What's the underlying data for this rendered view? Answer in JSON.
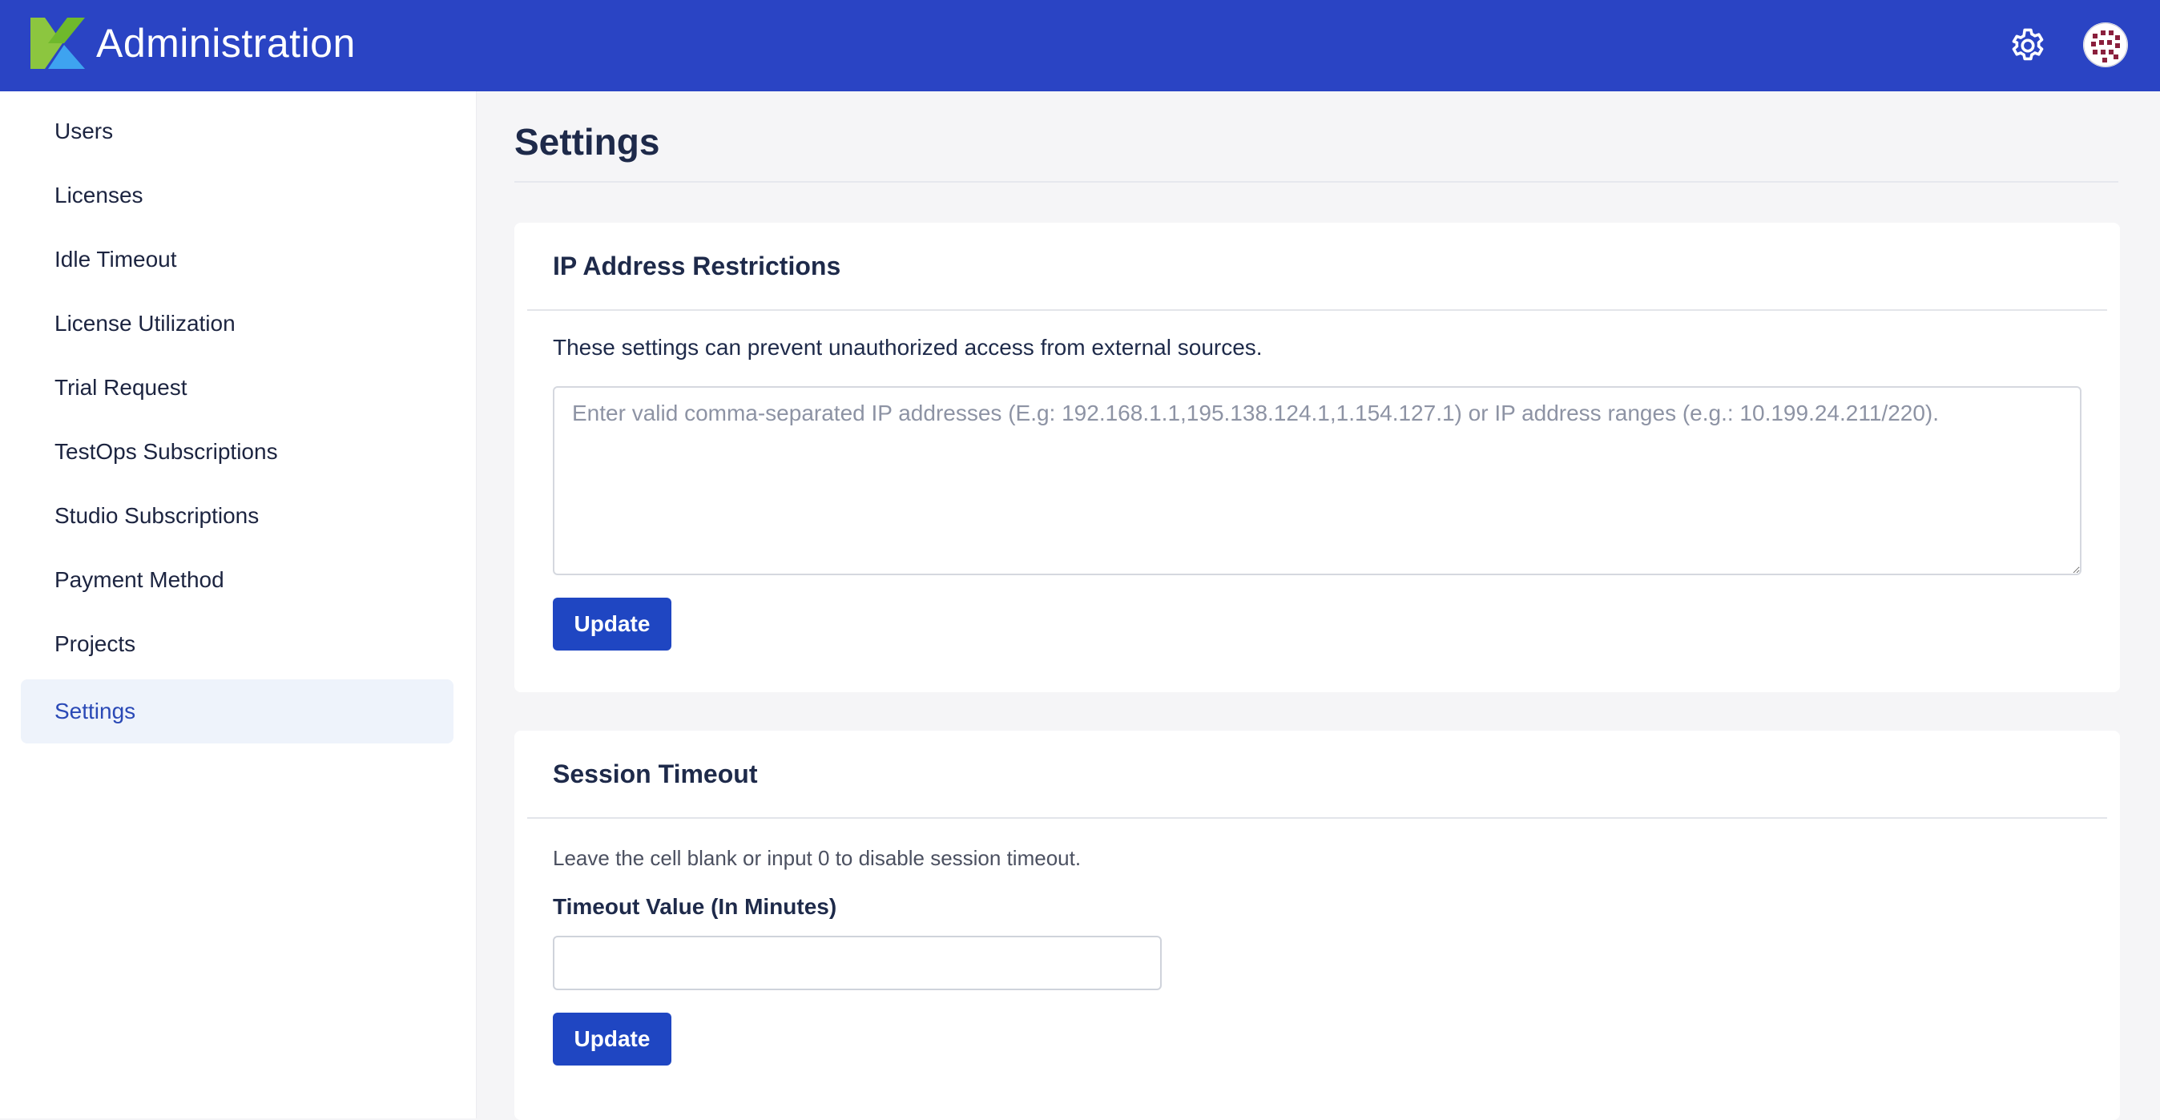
{
  "header": {
    "title": "Administration",
    "logo_icon": "katalon-k-logo-icon",
    "settings_icon": "gear-icon",
    "avatar_icon": "user-avatar-icon",
    "colors": {
      "bar": "#2a44c4",
      "logo_green": "#8cc63f",
      "logo_blue": "#3ea3f0"
    }
  },
  "sidebar": {
    "items": [
      {
        "label": "Users"
      },
      {
        "label": "Licenses"
      },
      {
        "label": "Idle Timeout"
      },
      {
        "label": "License Utilization"
      },
      {
        "label": "Trial Request"
      },
      {
        "label": "TestOps Subscriptions"
      },
      {
        "label": "Studio Subscriptions"
      },
      {
        "label": "Payment Method"
      },
      {
        "label": "Projects"
      },
      {
        "label": "Settings",
        "active": true
      }
    ]
  },
  "main": {
    "title": "Settings",
    "ip_card": {
      "title": "IP Address Restrictions",
      "description": "These settings can prevent unauthorized access from external sources.",
      "textarea_placeholder": "Enter valid comma-separated IP addresses (E.g: 192.168.1.1,195.138.124.1,1.154.127.1) or IP address ranges (e.g.: 10.199.24.211/220).",
      "textarea_value": "",
      "button_label": "Update"
    },
    "session_card": {
      "title": "Session Timeout",
      "description": "Leave the cell blank or input 0 to disable session timeout.",
      "field_label": "Timeout Value (In Minutes)",
      "input_value": "",
      "button_label": "Update"
    },
    "colors": {
      "accent": "#1f46c2",
      "active_bg": "#eef3fb"
    }
  }
}
